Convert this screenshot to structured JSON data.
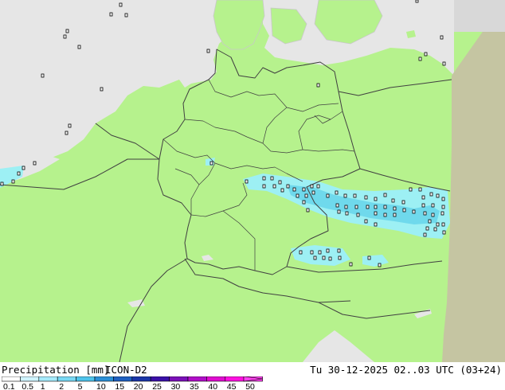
{
  "title": "Precipitation [mm]",
  "model": "ICON-D2",
  "valid_time": "Tu 30-12-2025 02..03 UTC (03+24)",
  "legend": {
    "ticks": [
      "0.1",
      "0.5",
      "1",
      "2",
      "5",
      "10",
      "15",
      "20",
      "25",
      "30",
      "35",
      "40",
      "45",
      "50"
    ],
    "colors": [
      "#ffffff",
      "#cff4ff",
      "#a6ebfd",
      "#78d8f4",
      "#4ec4ec",
      "#2b8fd7",
      "#1e5fc0",
      "#1a35a8",
      "#3a10a8",
      "#7b10b8",
      "#b00ec8",
      "#e00cd0",
      "#ff10e0",
      "#ff40f0"
    ]
  },
  "colors": {
    "land": "#b6f28d",
    "land_outside_domain": "#c5c5a2",
    "sea": "#e6e6e6",
    "borders": "#404040",
    "light_precip": "#9df0f4",
    "moderate_precip": "#6fd9ec"
  }
}
